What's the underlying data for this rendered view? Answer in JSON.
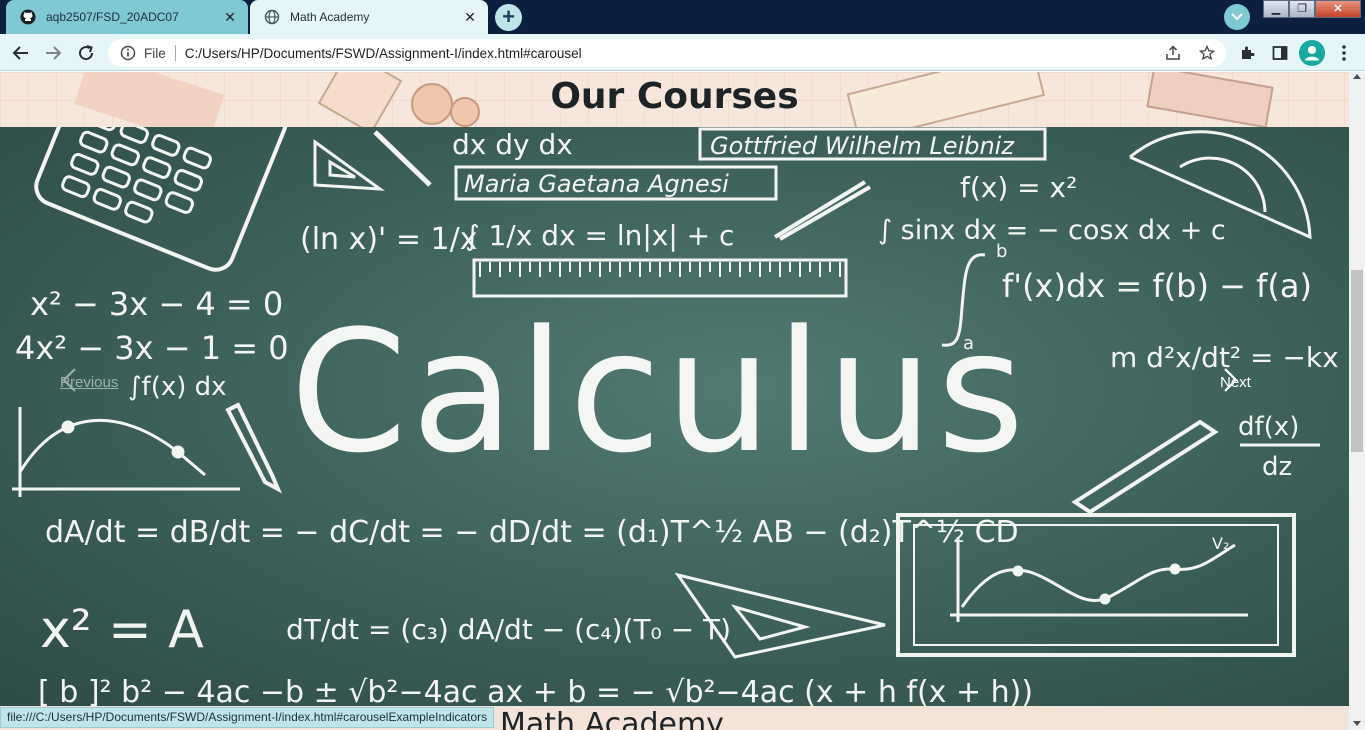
{
  "browser": {
    "tabs": [
      {
        "title": "aqb2507/FSD_20ADC07",
        "icon": "github-icon",
        "active": false
      },
      {
        "title": "Math Academy",
        "icon": "globe-icon",
        "active": true
      }
    ],
    "address": {
      "scheme": "File",
      "url": "C:/Users/HP/Documents/FSWD/Assignment-I/index.html#carousel"
    },
    "status_url": "file:///C:/Users/HP/Documents/FSWD/Assignment-I/index.html#carouselExampleIndicators",
    "colors": {
      "tabbar": "#0c1f3f",
      "active_tab": "#e6f5f7",
      "inactive_tab": "#7fc9d2"
    }
  },
  "page": {
    "section_title": "Our Courses",
    "carousel": {
      "slide_word": "Calculus",
      "prev_label": "Previous",
      "next_label": "Next",
      "board_color": "#3c5f59"
    },
    "next_section_peek": "Math Academy"
  },
  "chalk": {
    "names": [
      "Gottfried Wilhelm Leibniz",
      "Maria Gaetana Agnesi"
    ],
    "formulas": {
      "frac_dx_dy_dx": "dx    dy    dx",
      "fx": "f(x) = x²",
      "ln": "(ln x)' = 1/x",
      "int_1x": "∫ 1/x dx = ln|x| + c",
      "sinx": "∫ sinx dx = − cosx dx + c",
      "quad1": "x² − 3x − 4 = 0",
      "quad2": "4x² − 3x − 1 = 0",
      "ftc": "f'(x)dx = f(b) − f(a)",
      "int_lower": "a",
      "int_upper": "b",
      "int_fx": "∫f(x) dx",
      "md2x": "m d²x/dt² = −kx",
      "dfx": "df(x)",
      "dz": "dz",
      "rates": "dA/dt = dB/dt = − dC/dt = − dD/dt = (d₁)T^½ AB − (d₂)T^½ CD",
      "x2A": "x² = A",
      "dT": "dT/dt = (c₃) dA/dt − (c₄)(T₀ − T)",
      "bottom": "[    b ]²  b² − 4ac    −b ± √b²−4ac    ax + b = − √b²−4ac     (x + h  f(x + h))",
      "v2": "V₂"
    }
  }
}
